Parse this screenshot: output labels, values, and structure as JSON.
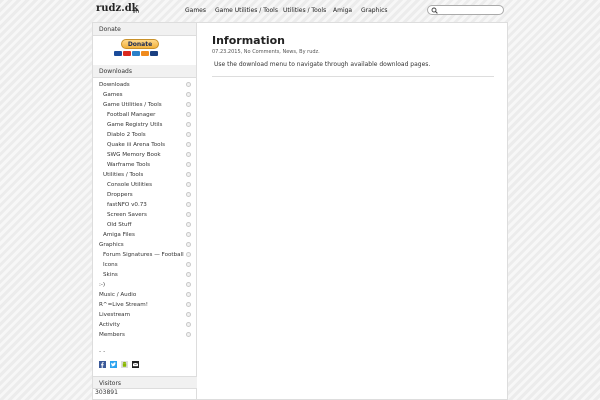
{
  "site": {
    "logo": "rudz.dk"
  },
  "nav": {
    "items": [
      "Games",
      "Game Utilities / Tools",
      "Utilities / Tools",
      "Amiga",
      "Graphics"
    ]
  },
  "search": {
    "placeholder": ""
  },
  "sidebar": {
    "donate_heading": "Donate",
    "donate_button": "Donate",
    "downloads_heading": "Downloads",
    "menu": [
      "Downloads",
      "Games",
      "Game Utilities / Tools",
      "Football Manager",
      "Game Registry Utils",
      "Diablo 2 Tools",
      "Quake iii Arena Tools",
      "SWG Memory Book",
      "Warframe Tools",
      "Utilities / Tools",
      "Console Utilities",
      "Droppers",
      "fastNFO v0.73",
      "Screen Savers",
      "Old Stuff",
      "Amiga Files",
      "Graphics",
      "Forum Signatures — Football",
      "Icons",
      "Skins",
      ":-)",
      "Music / Audio",
      "R^=Live Stream!",
      "Livestream",
      "Activity",
      "Members"
    ],
    "dashes": "- -",
    "visitors_heading": "Visitors",
    "visitors_count": "303891"
  },
  "post": {
    "title": "Information",
    "meta": "07.23.2015, No Comments, News, By rudz.",
    "body": "Use the download menu to navigate through available download pages."
  },
  "colors": {
    "paypal_button": "#f3b33d",
    "accent": "#2a5db0"
  }
}
